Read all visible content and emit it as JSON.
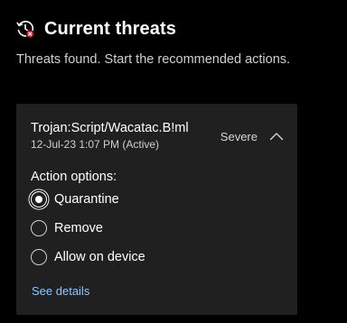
{
  "header": {
    "title": "Current threats",
    "icon": "threat-history-icon"
  },
  "subtitle": "Threats found. Start the recommended actions.",
  "threat": {
    "name": "Trojan:Script/Wacatac.B!ml",
    "detected": "12-Jul-23 1:07 PM (Active)",
    "severity": "Severe",
    "expanded": true,
    "action_options_label": "Action options:",
    "options": [
      {
        "label": "Quarantine",
        "selected": true
      },
      {
        "label": "Remove",
        "selected": false
      },
      {
        "label": "Allow on device",
        "selected": false
      }
    ],
    "see_details_label": "See details"
  },
  "colors": {
    "background": "#000000",
    "card": "#202020",
    "link": "#8cc8ff",
    "alert_badge": "#e81123"
  }
}
